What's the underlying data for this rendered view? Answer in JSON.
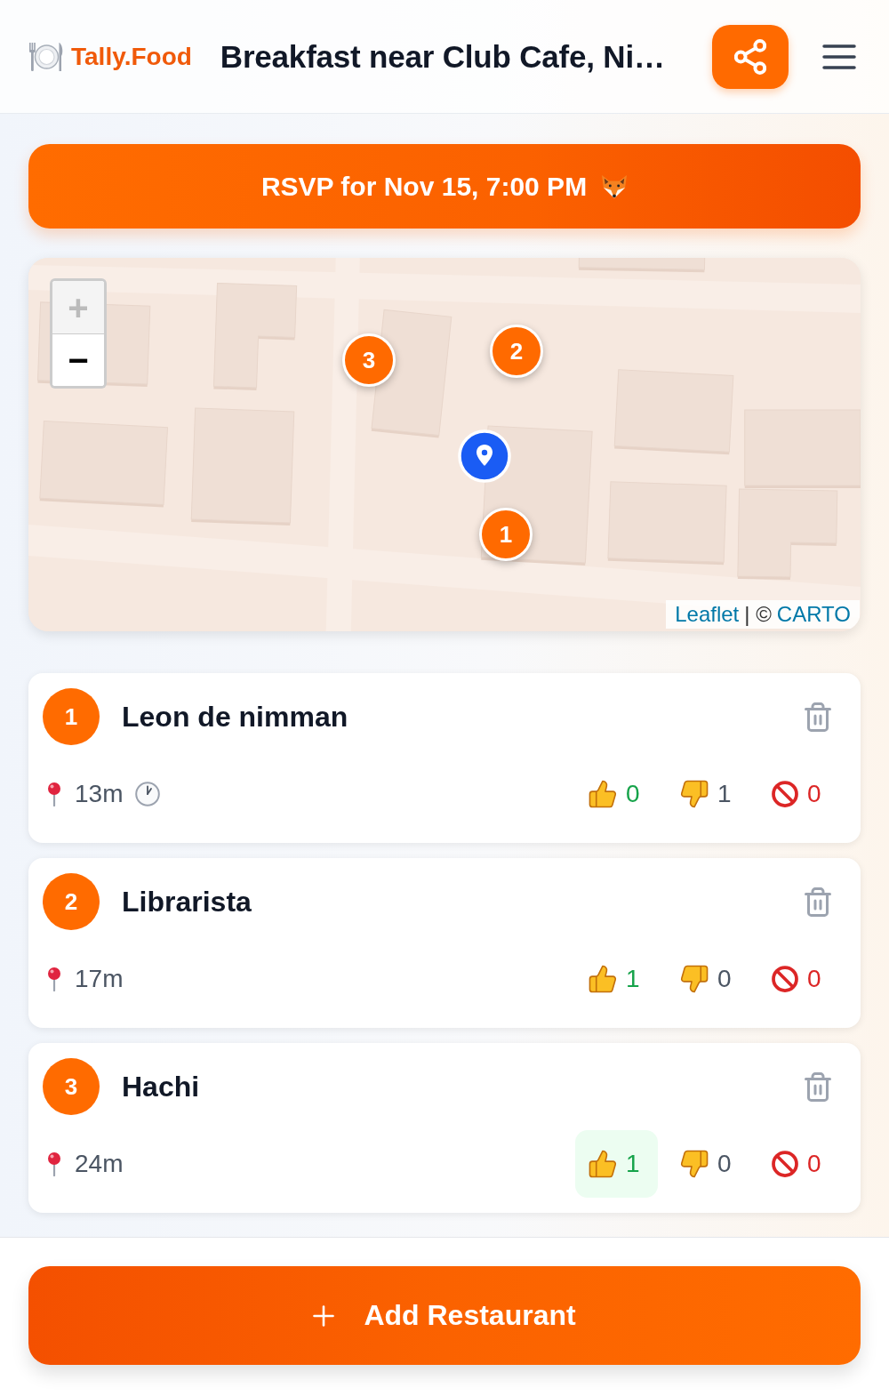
{
  "header": {
    "logo_text": "Tally.Food",
    "title": "Breakfast near Club Cafe, Ni…"
  },
  "rsvp_button": {
    "label": "RSVP for Nov 15, 7:00 PM"
  },
  "map": {
    "zoom_in": {
      "label": "+",
      "disabled": true
    },
    "zoom_out": {
      "label": "−",
      "disabled": false
    },
    "markers": [
      {
        "label": "3"
      },
      {
        "label": "2"
      },
      {
        "label": "1"
      }
    ],
    "attribution": {
      "links": [
        "Leaflet",
        "CARTO"
      ],
      "separator": "| ©"
    }
  },
  "restaurants": [
    {
      "number": "1",
      "name": "Leon de nimman",
      "distance": "13m",
      "clock": true,
      "votes": [
        {
          "kind": "up",
          "count": "0",
          "selected": false
        },
        {
          "kind": "down",
          "count": "1",
          "selected": false
        },
        {
          "kind": "veto",
          "count": "0",
          "selected": false
        }
      ]
    },
    {
      "number": "2",
      "name": "Librarista",
      "distance": "17m",
      "clock": false,
      "votes": [
        {
          "kind": "up",
          "count": "1",
          "selected": false
        },
        {
          "kind": "down",
          "count": "0",
          "selected": false
        },
        {
          "kind": "veto",
          "count": "0",
          "selected": false
        }
      ]
    },
    {
      "number": "3",
      "name": "Hachi",
      "distance": "24m",
      "clock": false,
      "votes": [
        {
          "kind": "up",
          "count": "1",
          "selected": true
        },
        {
          "kind": "down",
          "count": "0",
          "selected": false
        },
        {
          "kind": "veto",
          "count": "0",
          "selected": false
        }
      ]
    }
  ],
  "add_button": {
    "label": "Add Restaurant"
  }
}
